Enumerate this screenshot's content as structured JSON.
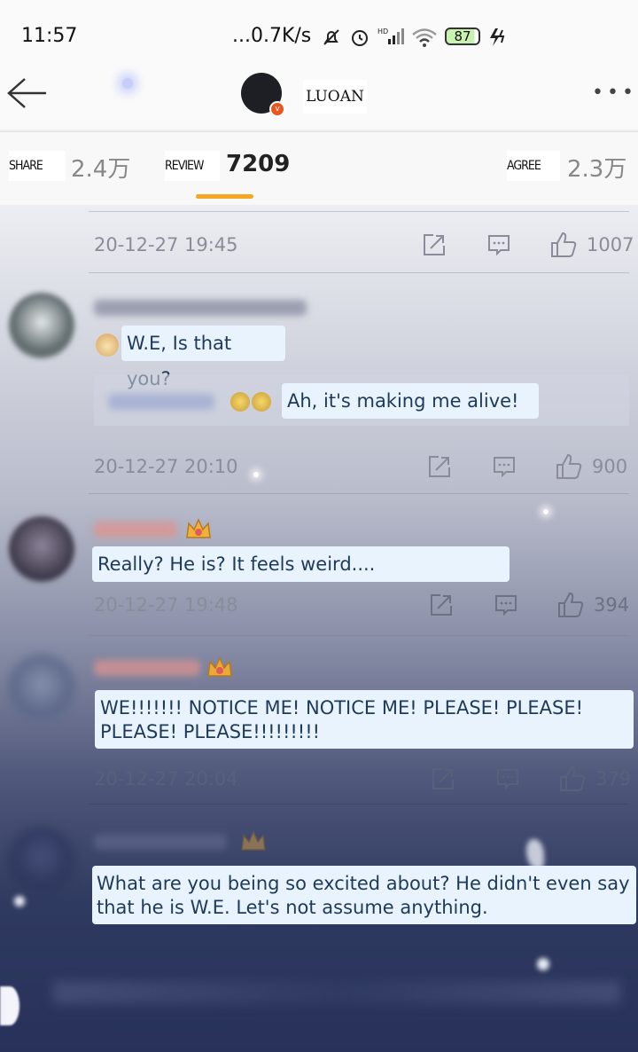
{
  "status_bar": {
    "time": "11:57",
    "network_speed": "...0.7K/s",
    "battery": "87",
    "icons": [
      "mute-bell-icon",
      "alarm-icon",
      "hd-signal-icon",
      "wifi-icon",
      "battery-icon",
      "charging-icon"
    ]
  },
  "header": {
    "username": "LUOAN",
    "back_icon": "arrow-left-icon",
    "more_icon": "more-dots-icon"
  },
  "tabs": {
    "share_label": "SHARE",
    "share_count": "2.4万",
    "review_label": "REVIEW",
    "review_count": "7209",
    "agree_label": "AGREE",
    "agree_count": "2.3万",
    "active_color": "#f5a623"
  },
  "comments": [
    {
      "date": "20-12-27 19:45",
      "likes": "1007",
      "text": ""
    },
    {
      "date": "20-12-27 20:10",
      "likes": "900",
      "text": "W.E, Is that you?",
      "reply": "Ah, it's making me alive!"
    },
    {
      "date": "20-12-27 19:48",
      "likes": "394",
      "text": "Really? He is? It feels weird...."
    },
    {
      "date": "20-12-27 20:04",
      "likes": "379",
      "text": "WE!!!!!!! NOTICE ME! NOTICE ME! PLEASE! PLEASE! PLEASE! PLEASE!!!!!!!!!"
    },
    {
      "text": "What are you being so excited about? He didn't even say that he is W.E. Let's not assume anything."
    }
  ],
  "colors": {
    "bubble_bg": "#e9f3fd",
    "bubble_text": "#1e3a5a",
    "meta_text": "#8a8d99"
  }
}
